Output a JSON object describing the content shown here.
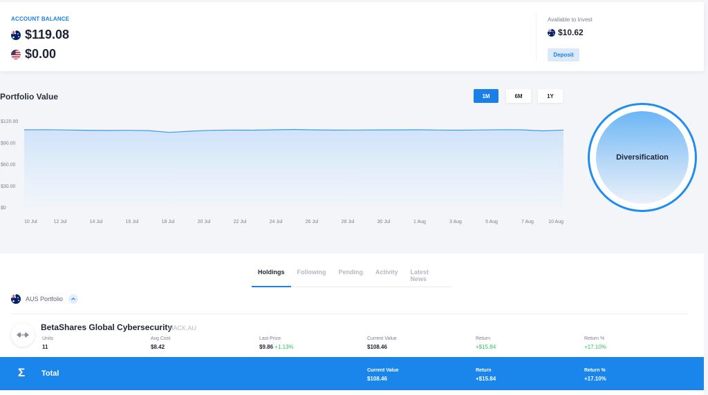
{
  "account": {
    "label": "ACCOUNT BALANCE",
    "balances": [
      {
        "currency": "AUD",
        "flag": "australia-flag-icon",
        "value": "$119.08"
      },
      {
        "currency": "USD",
        "flag": "usa-flag-icon",
        "value": "$0.00"
      }
    ],
    "available_label": "Available to Invest",
    "available_value": "$10.62",
    "deposit_label": "Deposit"
  },
  "portfolio": {
    "title": "Portfolio Value",
    "ranges": [
      "1M",
      "6M",
      "1Y"
    ],
    "active_range": "1M"
  },
  "chart_data": {
    "type": "area",
    "title": "Portfolio Value",
    "x_ticks": [
      "10 Jul",
      "12 Jul",
      "14 Jul",
      "16 Jul",
      "18 Jul",
      "20 Jul",
      "22 Jul",
      "24 Jul",
      "26 Jul",
      "28 Jul",
      "30 Jul",
      "1 Aug",
      "3 Aug",
      "5 Aug",
      "7 Aug",
      "10 Aug"
    ],
    "y_ticks": [
      "$120.00",
      "$90.00",
      "$60.00",
      "$30.00",
      "$0"
    ],
    "ylim": [
      0,
      120
    ],
    "series": [
      {
        "values": [
          108.5,
          108.7,
          108.3,
          107.9,
          107.6,
          107.8,
          107.4,
          104.9,
          106.6,
          107.8,
          108.1,
          108.0,
          108.5,
          109.0,
          108.4,
          108.1,
          108.2,
          108.4,
          108.4,
          108.6,
          108.2,
          108.0,
          108.3,
          108.7,
          108.5,
          107.0,
          108.2
        ]
      }
    ],
    "line_color": "#3d9be9",
    "fill_color": "#cfe3fa",
    "grid": false
  },
  "diversification": {
    "label": "Diversification"
  },
  "holdings": {
    "tabs": [
      "Holdings",
      "Following",
      "Pending",
      "Activity",
      "Latest News"
    ],
    "active_tab": "Holdings",
    "group_label": "AUS Portfolio",
    "item": {
      "name": "BetaShares Global Cybersecurity",
      "ticker": "HACK.AU",
      "units_label": "Units",
      "units": "11",
      "avg_cost_label": "Avg Cost",
      "avg_cost": "$8.42",
      "last_price_label": "Last Price",
      "last_price": "$9.86",
      "last_price_change": "+1.13%",
      "current_value_label": "Current Value",
      "current_value": "$108.46",
      "return_label": "Return",
      "return": "+$15.84",
      "return_pct_label": "Return %",
      "return_pct": "+17.10%"
    },
    "total": {
      "label": "Total",
      "current_value_label": "Current Value",
      "current_value": "$108.46",
      "return_label": "Return",
      "return": "+$15.84",
      "return_pct_label": "Return %",
      "return_pct": "+17.10%"
    }
  }
}
